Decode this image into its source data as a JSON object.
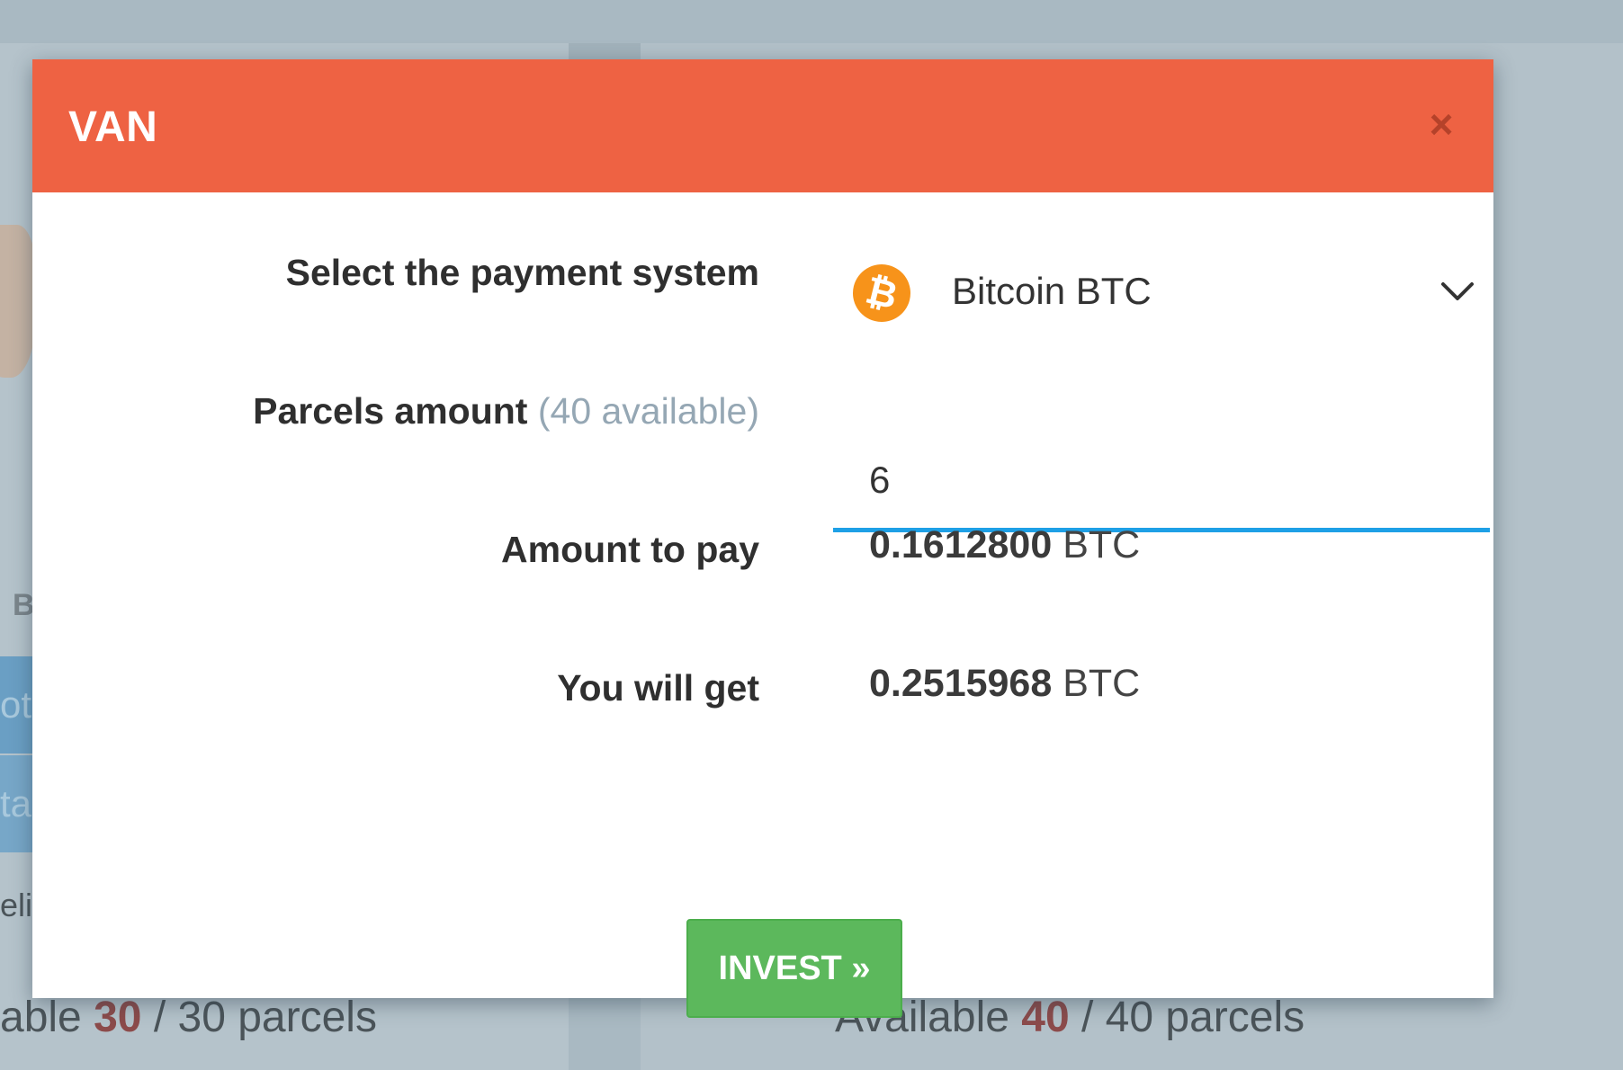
{
  "background": {
    "left_letter_b": "B",
    "left_btn_1": "ot",
    "left_btn_2": "ta",
    "left_text": "eli",
    "left_available": {
      "prefix": "able ",
      "count": "30",
      "suffix": " / 30 parcels"
    },
    "right_available": {
      "prefix": "Available ",
      "count": "40",
      "suffix": " / 40 parcels"
    }
  },
  "modal": {
    "title": "VAN",
    "close_glyph": "×",
    "payment": {
      "label": "Select the payment system",
      "selected": "Bitcoin BTC",
      "icon": "bitcoin-icon",
      "icon_glyph": "₿"
    },
    "parcels": {
      "label": "Parcels amount",
      "hint": "(40 available)",
      "value": "6"
    },
    "amount_to_pay": {
      "label": "Amount to pay",
      "value": "0.1612800",
      "unit": "BTC"
    },
    "you_will_get": {
      "label": "You will get",
      "value": "0.2515968",
      "unit": "BTC"
    },
    "invest_label": "INVEST »"
  },
  "colors": {
    "header": "#ee6243",
    "invest": "#5cb85c",
    "input_underline": "#1ea0e6",
    "bitcoin": "#f7931a"
  }
}
